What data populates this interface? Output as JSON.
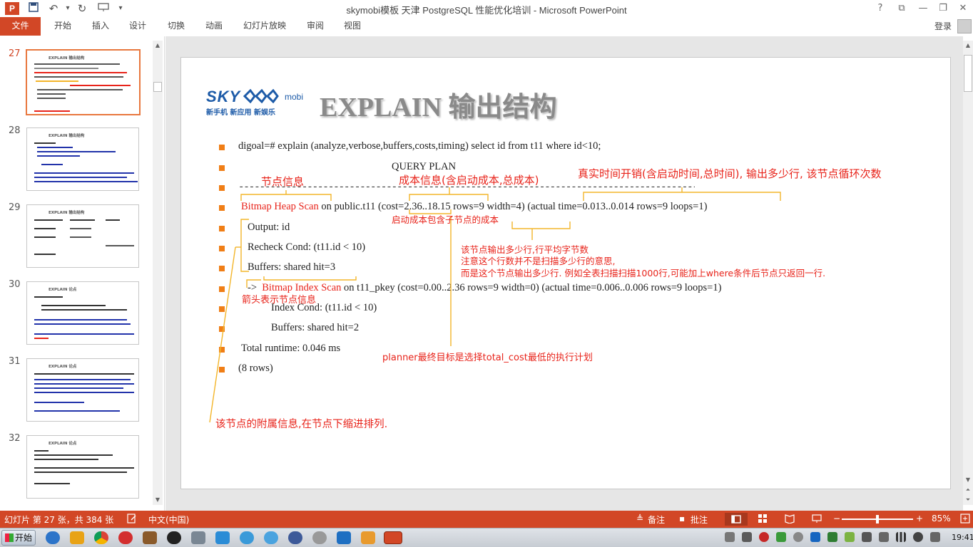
{
  "window": {
    "title": "skymobi模板 天津 PostgreSQL 性能优化培训 - Microsoft PowerPoint",
    "app_logo": "P",
    "quick_access": [
      "save-icon",
      "undo-icon",
      "redo-icon",
      "presenter-icon",
      "more-icon"
    ],
    "controls": [
      "?",
      "⧉",
      "—",
      "❐",
      "✕"
    ]
  },
  "ribbon": {
    "tabs": [
      "文件",
      "开始",
      "插入",
      "设计",
      "切换",
      "动画",
      "幻灯片放映",
      "审阅",
      "视图"
    ],
    "active_tab": "文件",
    "login": "登录"
  },
  "thumbnails": [
    {
      "number": "27",
      "title": "EXPLAIN 输出结构",
      "selected": true
    },
    {
      "number": "28",
      "title": "EXPLAIN 输出结构",
      "selected": false
    },
    {
      "number": "29",
      "title": "EXPLAIN 输出结构",
      "selected": false
    },
    {
      "number": "30",
      "title": "EXPLAIN 论点",
      "selected": false
    },
    {
      "number": "31",
      "title": "EXPLAIN 论点",
      "selected": false
    },
    {
      "number": "32",
      "title": "EXPLAIN 论点",
      "selected": false
    }
  ],
  "slide": {
    "logo_text": "SKY",
    "logo_suffix": "mobi",
    "logo_tagline": "新手机 新应用 新娱乐",
    "title": "EXPLAIN 输出结构",
    "lines": {
      "l1": "digoal=# explain (analyze,verbose,buffers,costs,timing) select id from t11 where id<10;",
      "l2": "QUERY PLAN",
      "l3": "----------------------------------------------------------------------------------------------------------------------------------------",
      "l4_red": "Bitmap Heap Scan",
      "l4": " on public.t11  (cost=2.36..18.15 rows=9 width=4) (actual time=0.013..0.014 rows=9 loops=1)",
      "l5": "Output: id",
      "l6": "Recheck Cond: (t11.id < 10)",
      "l7": "Buffers: shared hit=3",
      "l8_arrow": "->",
      "l8_red": "Bitmap Index Scan",
      "l8": " on t11_pkey  (cost=0.00..2.36 rows=9 width=0) (actual time=0.006..0.006 rows=9 loops=1)",
      "l9": "Index Cond: (t11.id < 10)",
      "l10": "Buffers: shared hit=2",
      "l11": "Total runtime: 0.046 ms",
      "l12": "(8 rows)"
    },
    "notes": {
      "node_info": "节点信息",
      "cost_info": "成本信息(含启动成本,总成本)",
      "actual_info": "真实时间开销(含启动时间,总时间), 输出多少行, 该节点循环次数",
      "startup_cost": "启动成本包含子节点的成本",
      "rows_1": "该节点输出多少行,行平均字节数",
      "rows_2": "注意这个行数并不是扫描多少行的意思,",
      "rows_3": "而是这个节点输出多少行. 例如全表扫描扫描1000行,可能加上where条件后节点只返回一行.",
      "arrow_note": "箭头表示节点信息",
      "planner": "planner最终目标是选择total_cost最低的执行计划",
      "attached": "该节点的附属信息,在节点下缩进排列."
    }
  },
  "statusbar": {
    "slide_info": "幻灯片 第 27 张，共 384 张",
    "language": "中文(中国)",
    "notes_btn": "备注",
    "comments_btn": "批注",
    "zoom_minus": "−",
    "zoom_plus": "+",
    "zoom": "85%",
    "zoom_level": 0.5
  },
  "taskbar": {
    "start": "开始",
    "clock": "19:41"
  },
  "colors": {
    "accent": "#d24726",
    "annotation_red": "#e8231a",
    "bracket": "#f3b52a",
    "bullet": "#f07e16"
  }
}
